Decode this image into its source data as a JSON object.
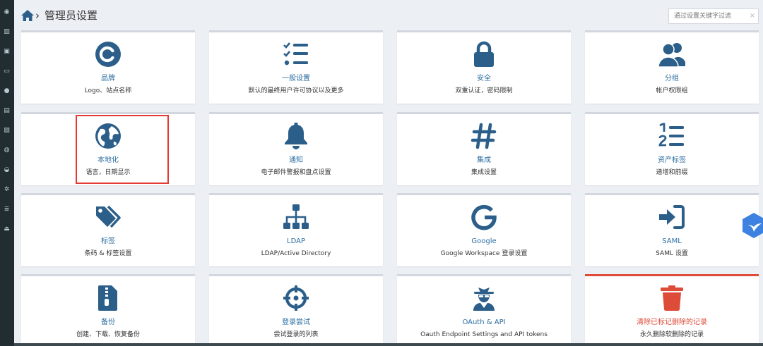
{
  "header": {
    "title": "管理员设置",
    "filter_placeholder": "通过设置关键字过滤",
    "clear_symbol": "×"
  },
  "colors": {
    "icon": "#2b5f8a",
    "link": "#2b6ea1",
    "danger": "#dd4b39",
    "sidebar": "#222d32"
  },
  "cards": [
    {
      "title": "品牌",
      "subtitle": "Logo、站点名称",
      "icon": "copyright-icon"
    },
    {
      "title": "一般设置",
      "subtitle": "默认的最终用户许可协议以及更多",
      "icon": "list-check-icon"
    },
    {
      "title": "安全",
      "subtitle": "双重认证，密码限制",
      "icon": "lock-icon"
    },
    {
      "title": "分组",
      "subtitle": "帐户权限组",
      "icon": "users-icon"
    },
    {
      "title": "本地化",
      "subtitle": "语言，日期显示",
      "icon": "globe-icon"
    },
    {
      "title": "通知",
      "subtitle": "电子邮件警报和盘点设置",
      "icon": "bell-icon"
    },
    {
      "title": "集成",
      "subtitle": "集成设置",
      "icon": "hashtag-icon"
    },
    {
      "title": "资产标签",
      "subtitle": "递增和前缀",
      "icon": "numbered-list-icon"
    },
    {
      "title": "标签",
      "subtitle": "条码 & 标签设置",
      "icon": "tags-icon"
    },
    {
      "title": "LDAP",
      "subtitle": "LDAP/Active Directory",
      "icon": "sitemap-icon"
    },
    {
      "title": "Google",
      "subtitle": "Google Workspace 登录设置",
      "icon": "google-icon"
    },
    {
      "title": "SAML",
      "subtitle": "SAML 设置",
      "icon": "sign-in-icon"
    },
    {
      "title": "备份",
      "subtitle": "创建、下载、恢复备份",
      "icon": "file-zipper-icon"
    },
    {
      "title": "登录尝试",
      "subtitle": "尝试登录的列表",
      "icon": "crosshairs-icon"
    },
    {
      "title": "OAuth & API",
      "subtitle": "Oauth Endpoint Settings and API tokens",
      "icon": "user-secret-icon"
    },
    {
      "title": "清除已标记删除的记录",
      "subtitle": "永久删除软删除的记录",
      "icon": "trash-icon"
    }
  ],
  "sidebar_icons": [
    "dashboard-icon",
    "barcode-icon",
    "license-icon",
    "keyboard-icon",
    "consumable-icon",
    "component-icon",
    "image-icon",
    "users-icon",
    "download-icon",
    "settings-icon",
    "report-icon",
    "eject-icon"
  ]
}
